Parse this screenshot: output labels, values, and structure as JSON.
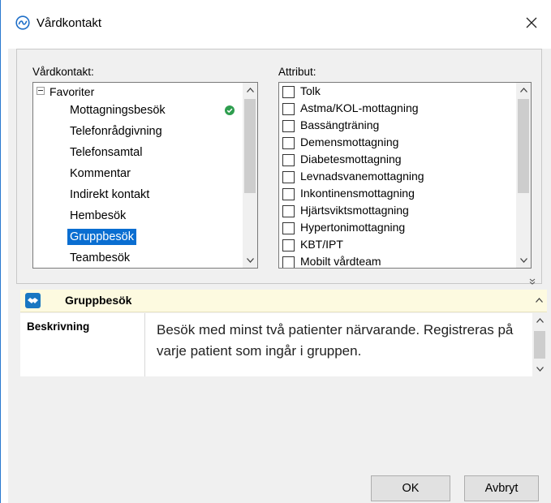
{
  "window": {
    "title": "Vårdkontakt",
    "app_icon": "app-logo-icon",
    "close_icon": "close-icon"
  },
  "left_panel": {
    "label": "Vårdkontakt:",
    "root": "Favoriter",
    "items": [
      {
        "label": "Mottagningsbesök",
        "checked_icon": true
      },
      {
        "label": "Telefonrådgivning"
      },
      {
        "label": "Telefonsamtal"
      },
      {
        "label": "Kommentar"
      },
      {
        "label": "Indirekt kontakt"
      },
      {
        "label": "Hembesök"
      },
      {
        "label": "Gruppbesök",
        "selected": true
      },
      {
        "label": "Teambesök"
      }
    ]
  },
  "right_panel": {
    "label": "Attribut:",
    "items": [
      "Tolk",
      "Astma/KOL-mottagning",
      "Bassängträning",
      "Demensmottagning",
      "Diabetesmottagning",
      "Levnadsvanemottagning",
      "Inkontinensmottagning",
      "Hjärtsviktsmottagning",
      "Hypertonimottagning",
      "KBT/IPT",
      "Mobilt vårdteam"
    ]
  },
  "info": {
    "title": "Gruppbesök",
    "description_label": "Beskrivning",
    "description_text": "Besök med minst två patienter närvarande. Registreras på varje patient som ingår i gruppen."
  },
  "buttons": {
    "ok": "OK",
    "cancel": "Avbryt"
  },
  "colors": {
    "selection": "#0a6ed1",
    "check_green": "#2e9e4f",
    "info_header_bg": "#fdfae0",
    "window_border": "#2b79d0"
  }
}
